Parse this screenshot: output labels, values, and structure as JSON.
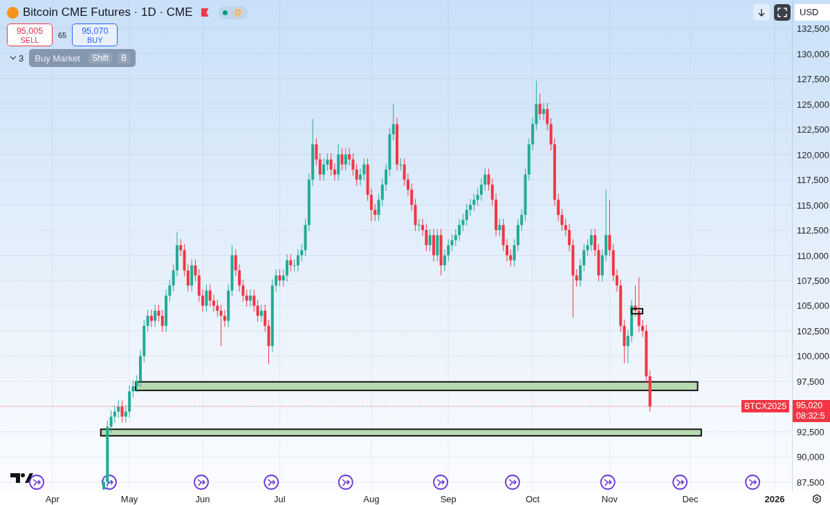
{
  "header": {
    "title": "Bitcoin CME Futures · 1D · CME",
    "badge": "D",
    "sell": {
      "price": "95,005",
      "label": "SELL"
    },
    "spread": "65",
    "buy": {
      "price": "95,070",
      "label": "BUY"
    },
    "collapse_count": "3",
    "tooltip": {
      "label": "Buy Market",
      "keys": [
        "Shift",
        "B"
      ]
    }
  },
  "toolbar": {
    "currency": "USD"
  },
  "last_price": {
    "symbol": "BTCX2025",
    "price": "95,020",
    "countdown": "08:32:5"
  },
  "drawings": [
    {
      "kind": "zone"
    },
    {
      "kind": "zone"
    },
    {
      "kind": "box"
    }
  ],
  "chart_data": {
    "type": "candlestick",
    "grid": true,
    "ylim": [
      86540,
      135310
    ],
    "yticks": [
      {
        "value": 87500,
        "label": "87,500"
      },
      {
        "value": 90000,
        "label": "90,000"
      },
      {
        "value": 92500,
        "label": "92,500"
      },
      {
        "value": 97500,
        "label": "97,500"
      },
      {
        "value": 100000,
        "label": "100,000"
      },
      {
        "value": 102500,
        "label": "102,500"
      },
      {
        "value": 105000,
        "label": "105,000"
      },
      {
        "value": 107500,
        "label": "107,500"
      },
      {
        "value": 110000,
        "label": "110,000"
      },
      {
        "value": 112500,
        "label": "112,500"
      },
      {
        "value": 115000,
        "label": "115,000"
      },
      {
        "value": 117500,
        "label": "117,500"
      },
      {
        "value": 120000,
        "label": "120,000"
      },
      {
        "value": 122500,
        "label": "122,500"
      },
      {
        "value": 125000,
        "label": "125,000"
      },
      {
        "value": 127500,
        "label": "127,500"
      },
      {
        "value": 130000,
        "label": "130,000"
      },
      {
        "value": 132500,
        "label": "132,500"
      }
    ],
    "categories": [
      "Apr",
      null,
      null,
      null,
      null,
      null,
      null,
      null,
      null,
      null,
      null,
      null,
      null,
      null,
      null,
      null,
      null,
      null,
      null,
      null,
      null,
      "May",
      null,
      null,
      null,
      null,
      null,
      null,
      null,
      null,
      null,
      null,
      null,
      null,
      null,
      null,
      null,
      null,
      null,
      null,
      null,
      "Jun",
      null,
      null,
      null,
      null,
      null,
      null,
      null,
      null,
      null,
      null,
      null,
      null,
      null,
      null,
      null,
      null,
      null,
      null,
      null,
      null,
      "Jul",
      null,
      null,
      null,
      null,
      null,
      null,
      null,
      null,
      null,
      null,
      null,
      null,
      null,
      null,
      null,
      null,
      null,
      null,
      null,
      null,
      null,
      null,
      null,
      null,
      "Aug",
      null,
      null,
      null,
      null,
      null,
      null,
      null,
      null,
      null,
      null,
      null,
      null,
      null,
      null,
      null,
      null,
      null,
      null,
      null,
      null,
      "Sep",
      null,
      null,
      null,
      null,
      null,
      null,
      null,
      null,
      null,
      null,
      null,
      null,
      null,
      null,
      null,
      null,
      null,
      null,
      null,
      null,
      null,
      null,
      "Oct",
      null,
      null,
      null,
      null,
      null,
      null,
      null,
      null,
      null,
      null,
      null,
      null,
      null,
      null,
      null,
      null,
      null,
      null,
      null,
      null,
      "Nov",
      null,
      null,
      null,
      null,
      null,
      null,
      null,
      null,
      null,
      null,
      null,
      null,
      null,
      null,
      null,
      null,
      null,
      null,
      null,
      null,
      null,
      "Dec",
      null,
      null,
      null,
      null,
      null,
      null,
      null,
      null,
      null,
      null,
      null,
      null,
      null,
      null,
      null,
      null,
      null,
      null,
      null,
      null,
      null,
      null,
      "2026"
    ],
    "ref_lines": [
      {
        "axis": "y",
        "value": 95020,
        "color": "#f23645"
      }
    ],
    "ohlc": [
      null,
      null,
      null,
      null,
      null,
      null,
      null,
      null,
      null,
      null,
      null,
      null,
      null,
      null,
      [
        86800,
        88100,
        86700,
        87500
      ],
      [
        87500,
        93600,
        86900,
        93000
      ],
      [
        93000,
        94600,
        92400,
        94000
      ],
      [
        94000,
        95100,
        93400,
        94500
      ],
      [
        94500,
        95600,
        93900,
        95000
      ],
      [
        95000,
        95600,
        93400,
        94000
      ],
      [
        94000,
        95100,
        93400,
        94500
      ],
      [
        94500,
        97100,
        93900,
        96500
      ],
      [
        96500,
        97600,
        95900,
        97000
      ],
      [
        97000,
        98100,
        96400,
        97500
      ],
      [
        97500,
        100600,
        96900,
        100000
      ],
      [
        100000,
        103600,
        99400,
        103000
      ],
      [
        103000,
        104600,
        102400,
        104000
      ],
      [
        104000,
        104600,
        102900,
        103500
      ],
      [
        103500,
        105100,
        102900,
        104500
      ],
      [
        104500,
        105100,
        103400,
        104000
      ],
      [
        104000,
        104600,
        102400,
        103000
      ],
      [
        103000,
        106600,
        102400,
        106000
      ],
      [
        106000,
        107600,
        105400,
        107000
      ],
      [
        107000,
        109100,
        106400,
        108500
      ],
      [
        108500,
        112300,
        107900,
        111000
      ],
      [
        111000,
        111600,
        109900,
        110500
      ],
      [
        110500,
        111100,
        107900,
        108500
      ],
      [
        108500,
        109100,
        106400,
        107000
      ],
      [
        107000,
        109600,
        106400,
        109000
      ],
      [
        109000,
        109600,
        107400,
        108000
      ],
      [
        108000,
        108600,
        105400,
        106000
      ],
      [
        106000,
        106600,
        104400,
        105000
      ],
      [
        105000,
        107100,
        104400,
        106500
      ],
      [
        106500,
        107100,
        104900,
        105500
      ],
      [
        105500,
        106100,
        104400,
        105000
      ],
      [
        105000,
        105600,
        103900,
        104500
      ],
      [
        104500,
        105100,
        101000,
        104000
      ],
      [
        104000,
        104600,
        102900,
        103500
      ],
      [
        103500,
        107100,
        102900,
        106500
      ],
      [
        106500,
        111000,
        105900,
        110000
      ],
      [
        110000,
        110600,
        107900,
        108500
      ],
      [
        108500,
        109100,
        106400,
        107000
      ],
      [
        107000,
        107600,
        105400,
        106000
      ],
      [
        106000,
        106600,
        104900,
        105500
      ],
      [
        105500,
        106600,
        104900,
        106000
      ],
      [
        106000,
        106600,
        104400,
        105000
      ],
      [
        105000,
        105600,
        103400,
        104000
      ],
      [
        104000,
        105100,
        103400,
        104500
      ],
      [
        104500,
        105100,
        102400,
        103000
      ],
      [
        103000,
        103600,
        99200,
        101000
      ],
      [
        101000,
        107600,
        100400,
        107000
      ],
      [
        107000,
        108600,
        106400,
        108000
      ],
      [
        108000,
        108600,
        106900,
        107500
      ],
      [
        107500,
        108600,
        106900,
        108000
      ],
      [
        108000,
        110100,
        107400,
        109500
      ],
      [
        109500,
        110100,
        108400,
        109000
      ],
      [
        109000,
        109600,
        108400,
        109000
      ],
      [
        109000,
        110600,
        108400,
        110000
      ],
      [
        110000,
        111100,
        109400,
        110500
      ],
      [
        110500,
        113600,
        109900,
        113000
      ],
      [
        113000,
        118100,
        112400,
        117500
      ],
      [
        117500,
        123500,
        116900,
        121000
      ],
      [
        121000,
        121600,
        118900,
        119500
      ],
      [
        119500,
        120100,
        117400,
        118000
      ],
      [
        118000,
        119600,
        117400,
        119000
      ],
      [
        119000,
        120100,
        118400,
        119500
      ],
      [
        119500,
        120100,
        117900,
        118500
      ],
      [
        118500,
        119100,
        117400,
        118000
      ],
      [
        118000,
        121000,
        117400,
        120000
      ],
      [
        120000,
        120600,
        118400,
        119000
      ],
      [
        119000,
        120600,
        118400,
        120000
      ],
      [
        120000,
        120600,
        118900,
        119500
      ],
      [
        119500,
        120100,
        117900,
        118500
      ],
      [
        118500,
        119100,
        116900,
        117500
      ],
      [
        117500,
        118600,
        116900,
        118000
      ],
      [
        118000,
        119600,
        117400,
        119000
      ],
      [
        119000,
        119600,
        115400,
        116000
      ],
      [
        116000,
        116600,
        113400,
        114500
      ],
      [
        114500,
        115100,
        113400,
        114000
      ],
      [
        114000,
        116100,
        113400,
        115500
      ],
      [
        115500,
        117600,
        114900,
        117000
      ],
      [
        117000,
        119100,
        116400,
        118500
      ],
      [
        118500,
        122600,
        117900,
        122000
      ],
      [
        122000,
        125000,
        121400,
        123000
      ],
      [
        123000,
        123600,
        118400,
        119000
      ],
      [
        119000,
        119600,
        118400,
        119000
      ],
      [
        119000,
        119600,
        116900,
        117500
      ],
      [
        117500,
        118100,
        115900,
        116500
      ],
      [
        116500,
        117100,
        114400,
        115000
      ],
      [
        115000,
        115600,
        112400,
        113000
      ],
      [
        113000,
        113600,
        112400,
        113000
      ],
      [
        113000,
        113600,
        111900,
        112500
      ],
      [
        112500,
        113100,
        110400,
        111000
      ],
      [
        111000,
        112600,
        110400,
        112000
      ],
      [
        112000,
        112600,
        109400,
        110000
      ],
      [
        110000,
        112600,
        109400,
        112000
      ],
      [
        112000,
        112600,
        108000,
        109000
      ],
      [
        109000,
        110600,
        108400,
        110000
      ],
      [
        110000,
        111600,
        109400,
        111000
      ],
      [
        111000,
        112100,
        110400,
        111500
      ],
      [
        111500,
        112600,
        110900,
        112000
      ],
      [
        112000,
        113600,
        111400,
        113000
      ],
      [
        113000,
        114100,
        112400,
        113500
      ],
      [
        113500,
        115100,
        112900,
        114500
      ],
      [
        114500,
        115600,
        113900,
        115000
      ],
      [
        115000,
        116100,
        114400,
        115500
      ],
      [
        115500,
        116600,
        114900,
        116000
      ],
      [
        116000,
        117600,
        115400,
        117000
      ],
      [
        117000,
        118600,
        116400,
        118000
      ],
      [
        118000,
        118600,
        116400,
        117000
      ],
      [
        117000,
        117600,
        114900,
        115500
      ],
      [
        115500,
        116100,
        111900,
        112500
      ],
      [
        112500,
        113600,
        111900,
        113000
      ],
      [
        113000,
        113600,
        110400,
        111000
      ],
      [
        111000,
        111600,
        109400,
        110000
      ],
      [
        110000,
        110600,
        108900,
        109500
      ],
      [
        109500,
        111600,
        108900,
        111000
      ],
      [
        111000,
        113600,
        110400,
        113000
      ],
      [
        113000,
        114600,
        112400,
        114000
      ],
      [
        114000,
        118600,
        113400,
        118000
      ],
      [
        118000,
        121600,
        117400,
        121000
      ],
      [
        121000,
        123600,
        120400,
        123000
      ],
      [
        123000,
        127300,
        122400,
        125000
      ],
      [
        125000,
        126000,
        123400,
        124000
      ],
      [
        124000,
        125100,
        123400,
        124500
      ],
      [
        124500,
        125100,
        122400,
        123000
      ],
      [
        123000,
        123600,
        120400,
        121000
      ],
      [
        121000,
        121600,
        114900,
        115500
      ],
      [
        115500,
        116100,
        113400,
        114000
      ],
      [
        114000,
        114600,
        112400,
        113000
      ],
      [
        113000,
        113600,
        111900,
        112500
      ],
      [
        112500,
        113100,
        110400,
        111000
      ],
      [
        111000,
        111600,
        103800,
        108000
      ],
      [
        108000,
        108600,
        106900,
        107500
      ],
      [
        107500,
        109600,
        106900,
        109000
      ],
      [
        109000,
        111100,
        108400,
        110500
      ],
      [
        110500,
        111600,
        109900,
        111000
      ],
      [
        111000,
        112600,
        110400,
        112000
      ],
      [
        112000,
        112600,
        109900,
        110500
      ],
      [
        110500,
        111100,
        107400,
        108000
      ],
      [
        108000,
        110600,
        107400,
        110000
      ],
      [
        110000,
        116500,
        109400,
        112000
      ],
      [
        112000,
        115500,
        109900,
        110500
      ],
      [
        110500,
        111100,
        107400,
        108000
      ],
      [
        108000,
        108600,
        106400,
        107000
      ],
      [
        107000,
        107600,
        102400,
        103000
      ],
      [
        103000,
        103600,
        99300,
        101000
      ],
      [
        101000,
        102600,
        99300,
        102000
      ],
      [
        102000,
        105600,
        101400,
        105000
      ],
      [
        105000,
        107000,
        103900,
        104500
      ],
      [
        104500,
        107800,
        102400,
        103000
      ],
      [
        103000,
        103600,
        101900,
        102500
      ],
      [
        102500,
        103100,
        97400,
        98000
      ],
      [
        98000,
        98600,
        94500,
        95000
      ],
      null,
      null,
      null,
      null,
      null,
      null,
      null,
      null,
      null,
      null,
      null,
      null,
      null,
      null,
      null,
      null,
      null,
      null,
      null,
      null,
      null,
      null,
      null,
      null,
      null,
      null,
      null,
      null,
      null,
      null,
      null,
      null,
      null,
      null
    ]
  }
}
